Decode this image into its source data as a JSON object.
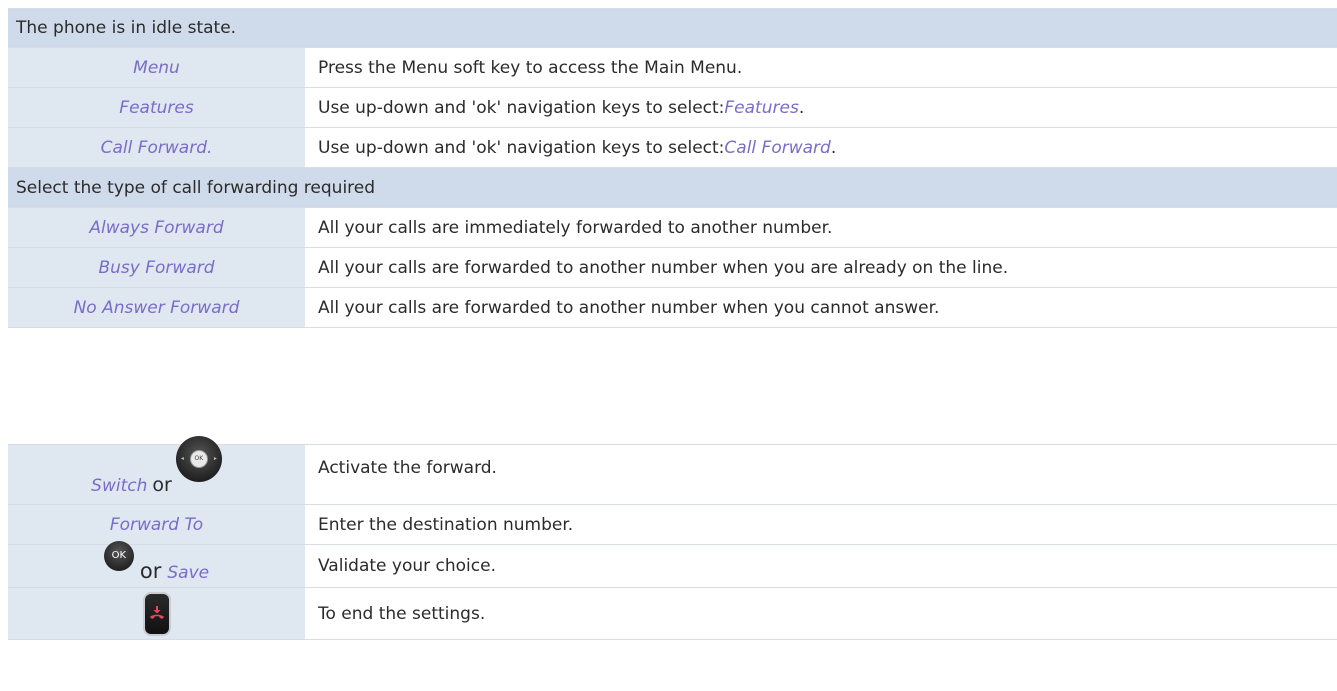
{
  "top_table": {
    "header_1": "The phone is in idle state.",
    "rows_1": [
      {
        "key": "Menu",
        "desc": "Press the Menu soft key to access the Main Menu.",
        "desc_em": ""
      },
      {
        "key": "Features",
        "desc": "Use up-down and 'ok' navigation keys to select: ",
        "desc_em": "Features",
        "desc_tail": "."
      },
      {
        "key": "Call Forward.",
        "desc": "Use up-down and 'ok' navigation keys to select: ",
        "desc_em": "Call Forward",
        "desc_tail": "."
      }
    ],
    "header_2": "Select the type of call forwarding required",
    "rows_2": [
      {
        "key": "Always Forward",
        "desc": "All your calls are immediately forwarded to another number."
      },
      {
        "key": "Busy Forward",
        "desc": "All your calls are forwarded to another number when you are already on the line."
      },
      {
        "key": "No Answer Forward",
        "desc": "All your calls are forwarded to another number when you cannot answer."
      }
    ]
  },
  "bottom_table": {
    "rows": [
      {
        "key": "Switch",
        "connector": "or",
        "desc": "Activate the forward.",
        "icon": "navigation-key-icon",
        "nav_ok": "OK",
        "nav_left": "◂",
        "nav_right": "▸"
      },
      {
        "key": "Forward To",
        "desc": "Enter the destination number."
      },
      {
        "key": "Save",
        "connector": "or",
        "desc": "Validate your choice.",
        "icon": "ok-key-icon",
        "ok_label": "OK"
      },
      {
        "key": "",
        "desc": "To end the settings.",
        "icon": "hang-up-key-icon"
      }
    ]
  },
  "colors": {
    "header_bg": "#cfdbea",
    "key_cell_bg": "#dfe7f1",
    "key_text": "#7a6cc8",
    "hangup_accent": "#e8475f"
  }
}
